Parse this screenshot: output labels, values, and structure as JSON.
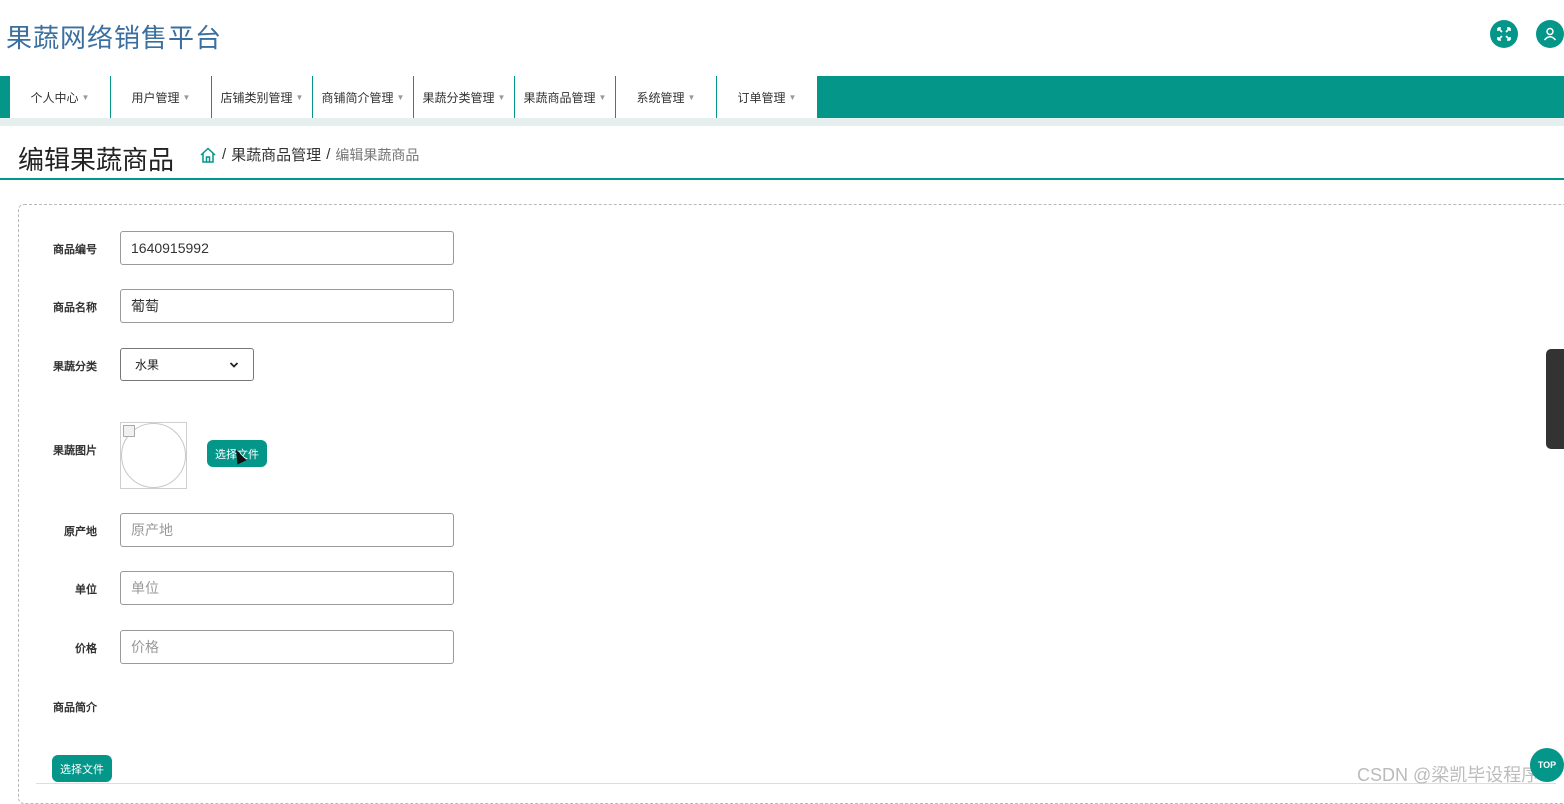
{
  "header": {
    "brand": "果蔬网络销售平台",
    "fullscreen_icon": "expand-icon",
    "user_icon": "user-icon",
    "accent_color": "#05968a"
  },
  "nav": {
    "items": [
      {
        "label": "个人中心"
      },
      {
        "label": "用户管理"
      },
      {
        "label": "店铺类别管理"
      },
      {
        "label": "商铺简介管理"
      },
      {
        "label": "果蔬分类管理"
      },
      {
        "label": "果蔬商品管理"
      },
      {
        "label": "系统管理"
      },
      {
        "label": "订单管理"
      }
    ]
  },
  "page": {
    "title": "编辑果蔬商品",
    "breadcrumb": {
      "home_icon": "home-icon",
      "sep": "/",
      "parent": "果蔬商品管理",
      "current": "编辑果蔬商品"
    }
  },
  "form": {
    "code": {
      "label": "商品编号",
      "value": "1640915992"
    },
    "name": {
      "label": "商品名称",
      "value": "葡萄"
    },
    "category": {
      "label": "果蔬分类",
      "value": "水果"
    },
    "image": {
      "label": "果蔬图片",
      "button": "选择文件"
    },
    "origin": {
      "label": "原产地",
      "placeholder": "原产地"
    },
    "unit": {
      "label": "单位",
      "placeholder": "单位"
    },
    "price": {
      "label": "价格",
      "placeholder": "价格"
    },
    "intro": {
      "label": "商品简介",
      "button": "选择文件"
    }
  },
  "footer": {
    "watermark": "CSDN @梁凯毕设程序",
    "top_button": "TOP"
  }
}
